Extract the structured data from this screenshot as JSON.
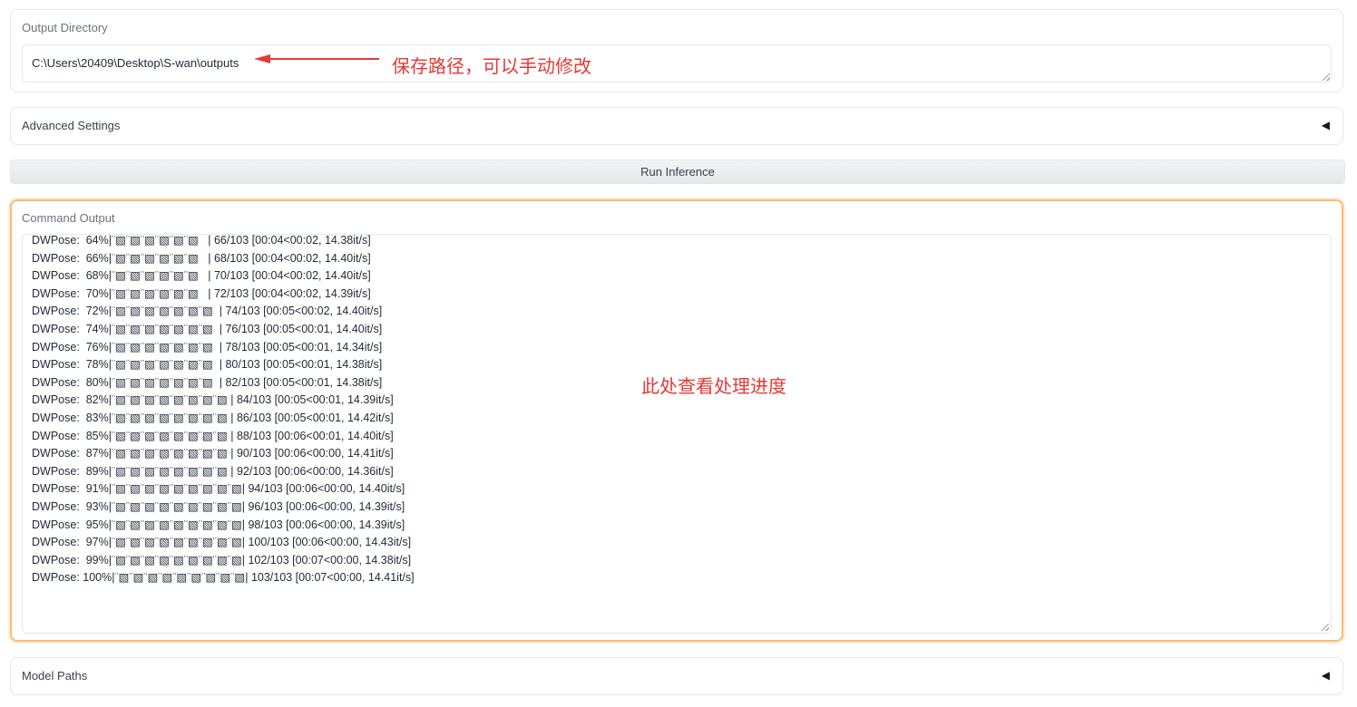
{
  "output_directory": {
    "label": "Output Directory",
    "value": "C:\\Users\\20409\\Desktop\\S-wan\\outputs",
    "annotation": "保存路径，可以手动修改"
  },
  "advanced_settings": {
    "label": "Advanced Settings",
    "arrow": "◀"
  },
  "run_button": {
    "label": "Run Inference"
  },
  "command_output": {
    "label": "Command Output",
    "annotation": "此处查看处理进度",
    "lines": [
      "DWPose:  64%|¨▧¨▧¨▧¨▧¨▧¨▧   | 66/103 [00:04<00:02, 14.38it/s]",
      "DWPose:  66%|¨▧¨▧¨▧¨▧¨▧¨▧   | 68/103 [00:04<00:02, 14.40it/s]",
      "DWPose:  68%|¨▧¨▧¨▧¨▧¨▧¨▧   | 70/103 [00:04<00:02, 14.40it/s]",
      "DWPose:  70%|¨▧¨▧¨▧¨▧¨▧¨▧   | 72/103 [00:04<00:02, 14.39it/s]",
      "DWPose:  72%|¨▧¨▧¨▧¨▧¨▧¨▧¨▧  | 74/103 [00:05<00:02, 14.40it/s]",
      "DWPose:  74%|¨▧¨▧¨▧¨▧¨▧¨▧¨▧  | 76/103 [00:05<00:01, 14.40it/s]",
      "DWPose:  76%|¨▧¨▧¨▧¨▧¨▧¨▧¨▧  | 78/103 [00:05<00:01, 14.34it/s]",
      "DWPose:  78%|¨▧¨▧¨▧¨▧¨▧¨▧¨▧  | 80/103 [00:05<00:01, 14.38it/s]",
      "DWPose:  80%|¨▧¨▧¨▧¨▧¨▧¨▧¨▧  | 82/103 [00:05<00:01, 14.38it/s]",
      "DWPose:  82%|¨▧¨▧¨▧¨▧¨▧¨▧¨▧¨▧ | 84/103 [00:05<00:01, 14.39it/s]",
      "DWPose:  83%|¨▧¨▧¨▧¨▧¨▧¨▧¨▧¨▧ | 86/103 [00:05<00:01, 14.42it/s]",
      "DWPose:  85%|¨▧¨▧¨▧¨▧¨▧¨▧¨▧¨▧ | 88/103 [00:06<00:01, 14.40it/s]",
      "DWPose:  87%|¨▧¨▧¨▧¨▧¨▧¨▧¨▧¨▧ | 90/103 [00:06<00:00, 14.41it/s]",
      "DWPose:  89%|¨▧¨▧¨▧¨▧¨▧¨▧¨▧¨▧ | 92/103 [00:06<00:00, 14.36it/s]",
      "DWPose:  91%|¨▧¨▧¨▧¨▧¨▧¨▧¨▧¨▧¨▧| 94/103 [00:06<00:00, 14.40it/s]",
      "DWPose:  93%|¨▧¨▧¨▧¨▧¨▧¨▧¨▧¨▧¨▧| 96/103 [00:06<00:00, 14.39it/s]",
      "DWPose:  95%|¨▧¨▧¨▧¨▧¨▧¨▧¨▧¨▧¨▧| 98/103 [00:06<00:00, 14.39it/s]",
      "DWPose:  97%|¨▧¨▧¨▧¨▧¨▧¨▧¨▧¨▧¨▧| 100/103 [00:06<00:00, 14.43it/s]",
      "DWPose:  99%|¨▧¨▧¨▧¨▧¨▧¨▧¨▧¨▧¨▧| 102/103 [00:07<00:00, 14.38it/s]",
      "DWPose: 100%|¨▧¨▧¨▧¨▧¨▧¨▧¨▧¨▧¨▧| 103/103 [00:07<00:00, 14.41it/s]"
    ]
  },
  "model_paths": {
    "label": "Model Paths",
    "arrow": "◀"
  },
  "colors": {
    "annotation_red": "#e53935",
    "focus_orange": "#fdba74",
    "border_gray": "#e5e7eb"
  }
}
